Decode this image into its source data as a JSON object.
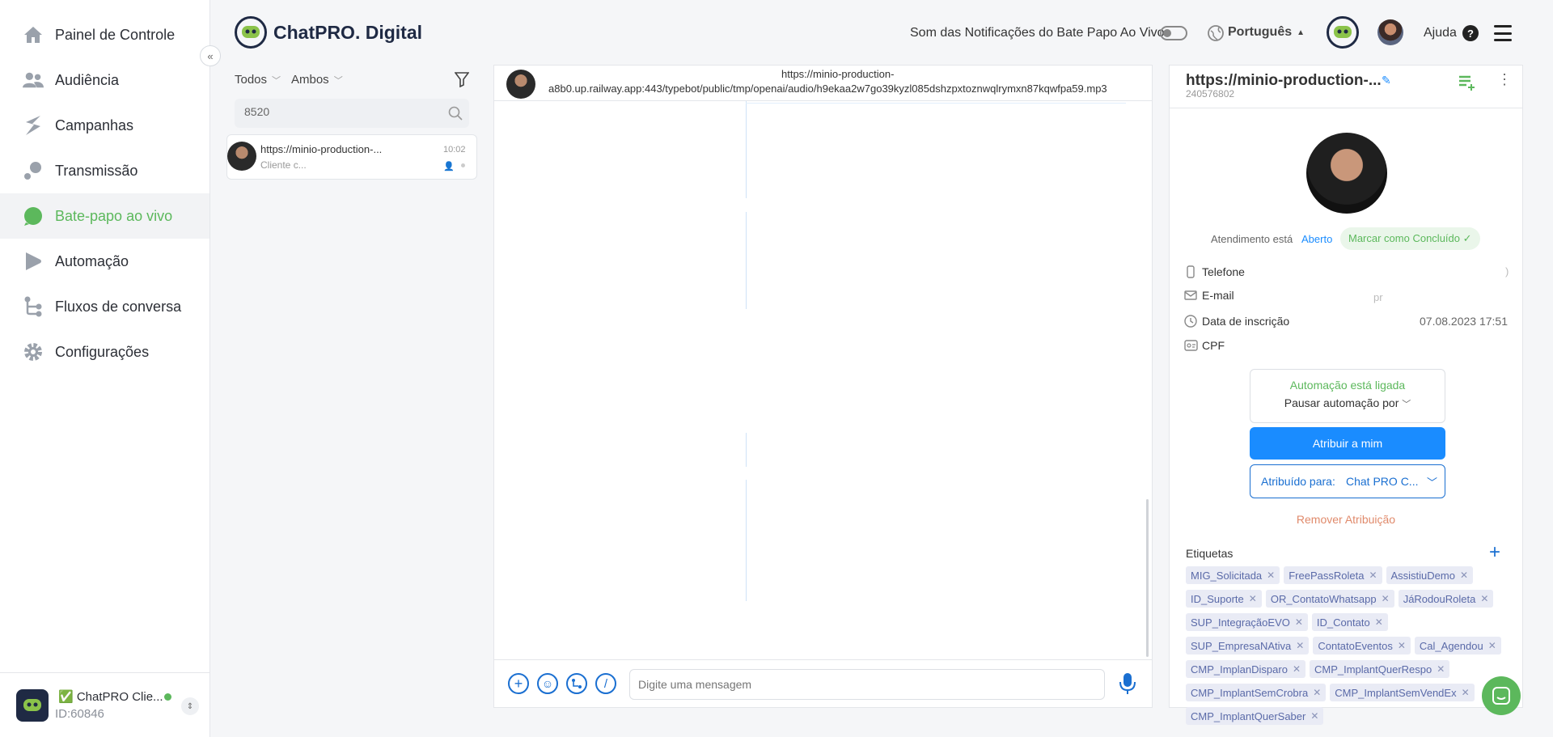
{
  "sidebar": {
    "items": [
      {
        "label": "Painel de Controle"
      },
      {
        "label": "Audiência"
      },
      {
        "label": "Campanhas"
      },
      {
        "label": "Transmissão"
      },
      {
        "label": "Bate-papo ao vivo"
      },
      {
        "label": "Automação"
      },
      {
        "label": "Fluxos de conversa"
      },
      {
        "label": "Configurações"
      }
    ],
    "active_color": "#5cb85c",
    "account": {
      "name": "✅ ChatPRO Clie...",
      "id": "ID:60846"
    }
  },
  "header": {
    "brand": "ChatPRO. Digital",
    "notif_label": "Som das Notificações do Bate Papo Ao Vivo",
    "language": "Português",
    "help": "Ajuda"
  },
  "chatlist": {
    "filter_status": "Todos",
    "filter_channel": "Ambos",
    "search_value": "8520",
    "conversations": [
      {
        "name": "https://minio-production-...",
        "preview": "Cliente c...",
        "time": "10:02"
      }
    ]
  },
  "chat": {
    "header_line1": "https://minio-production-",
    "header_line2": "a8b0.up.railway.app:443/typebot/public/tmp/openai/audio/h9ekaa2w7go39kyzl085dshzpxtoznwqlrymxn87kqwfpa59.mp3",
    "composer_placeholder": "Digite uma mensagem"
  },
  "contact": {
    "title": "https://minio-production-...",
    "subtitle": "240576802",
    "status_prefix": "Atendimento está",
    "status_value": "Aberto",
    "mark_done": "Marcar como Concluído ✓",
    "fields": [
      {
        "label": "Telefone",
        "value": ")"
      },
      {
        "label": "E-mail",
        "value": "pr"
      },
      {
        "label": "Data de inscrição",
        "value": "07.08.2023 17:51"
      },
      {
        "label": "CPF",
        "value": ""
      }
    ],
    "automation_status": "Automação está ligada",
    "automation_pause": "Pausar automação por",
    "assign_me": "Atribuir a mim",
    "assigned_prefix": "Atribuído para:",
    "assigned_value": "Chat PRO C...",
    "remove_assign": "Remover Atribuição",
    "tags_title": "Etiquetas",
    "tags": [
      "MIG_Solicitada",
      "FreePassRoleta",
      "AssistiuDemo",
      "ID_Suporte",
      "OR_ContatoWhatsapp",
      "JáRodouRoleta",
      "SUP_IntegraçãoEVO",
      "ID_Contato",
      "SUP_EmpresaNAtiva",
      "ContatoEventos",
      "Cal_Agendou",
      "CMP_ImplanDisparo",
      "CMP_ImplantQuerRespo",
      "CMP_ImplantSemCrobra",
      "CMP_ImplantSemVendEx",
      "CMP_ImplantQuerSaber"
    ]
  },
  "colors": {
    "primary": "#1a8cff",
    "green": "#5cb85c",
    "remove": "#e08a6b"
  }
}
